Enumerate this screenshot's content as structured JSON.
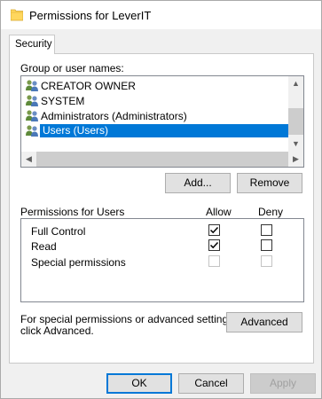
{
  "window": {
    "title": "Permissions for LeverIT",
    "icon": "folder-icon"
  },
  "tabs": [
    {
      "label": "Security",
      "active": true
    }
  ],
  "group_list": {
    "label": "Group or user names:",
    "items": [
      {
        "label": "CREATOR OWNER",
        "icon": "user-group-icon",
        "selected": false
      },
      {
        "label": "SYSTEM",
        "icon": "user-group-icon",
        "selected": false
      },
      {
        "label": "Administrators (Administrators)",
        "icon": "user-group-icon",
        "selected": false
      },
      {
        "label": "Users (Users)",
        "icon": "user-group-icon",
        "selected": true
      }
    ]
  },
  "list_buttons": {
    "add_label": "Add...",
    "remove_label": "Remove"
  },
  "permissions": {
    "header": "Permissions for Users",
    "allow_header": "Allow",
    "deny_header": "Deny",
    "rows": [
      {
        "label": "Full Control",
        "allow": true,
        "deny": false,
        "enabled": true
      },
      {
        "label": "Read",
        "allow": true,
        "deny": false,
        "enabled": true
      },
      {
        "label": "Special permissions",
        "allow": false,
        "deny": false,
        "enabled": false
      }
    ]
  },
  "advanced": {
    "text_line1": "For special permissions or advanced settings,",
    "text_line2": "click Advanced.",
    "button_label": "Advanced"
  },
  "footer": {
    "ok_label": "OK",
    "cancel_label": "Cancel",
    "apply_label": "Apply",
    "apply_enabled": false
  },
  "colors": {
    "selection": "#0078d7",
    "button_face": "#e1e1e1",
    "window_bg": "#f0f0f0"
  }
}
